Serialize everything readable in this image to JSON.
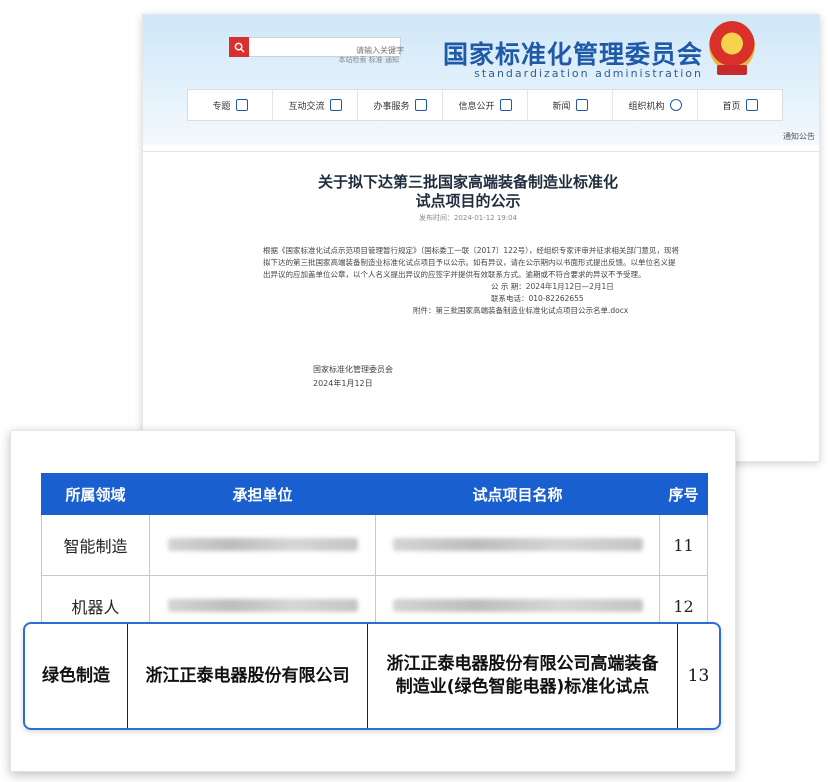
{
  "site": {
    "org_name": "国家标准化管理委员会",
    "org_name_en": "standardization administration",
    "search_placeholder": "请输入关键字",
    "search_hint": "本站检索  标准  通知"
  },
  "nav": [
    {
      "label": "首页",
      "icon": "home-icon"
    },
    {
      "label": "组织机构",
      "icon": "org-icon"
    },
    {
      "label": "新闻",
      "icon": "news-icon"
    },
    {
      "label": "信息公开",
      "icon": "doc-icon"
    },
    {
      "label": "办事服务",
      "icon": "service-icon"
    },
    {
      "label": "互动交流",
      "icon": "chat-icon"
    },
    {
      "label": "专题",
      "icon": "topic-icon"
    }
  ],
  "breadcrumb": "通知公告",
  "article": {
    "title_line1": "关于拟下达第三批国家高端装备制造业标准化",
    "title_line2": "试点项目的公示",
    "date": "发布时间：2024-01-12 19:04",
    "para1": "根据《国家标准化试点示范项目管理暂行规定》（国标委工一联〔2017〕122号），经组织专家评审并征求相关部门意见，现将拟下达的第三批国家高端装备制造业标准化试点项目予以公示。如有异议，请在公示期内以书面形式提出反馈。以单位名义提出异议的应加盖单位公章，以个人名义提出异议的应签字并提供有效联系方式。逾期或不符合要求的异议不予受理。",
    "period": "公 示 期：2024年1月12日—2月1日",
    "phone": "联系电话：010-82262655",
    "attachment": "附件：第三批国家高端装备制造业标准化试点项目公示名单.docx",
    "sign_org": "国家标准化管理委员会",
    "sign_date": "2024年1月12日"
  },
  "table": {
    "headers": [
      "序号",
      "试点项目名称",
      "承担单位",
      "所属领域"
    ],
    "rows": [
      {
        "seq": "11",
        "field": "智能制造"
      },
      {
        "seq": "12",
        "field": "机器人"
      }
    ],
    "highlight_row": {
      "seq": "13",
      "project_line1": "浙江正泰电器股份有限公司高端装备",
      "project_line2": "制造业(绿色智能电器)标准化试点",
      "unit": "浙江正泰电器股份有限公司",
      "field": "绿色制造"
    }
  },
  "colors": {
    "accent": "#1a5fcf",
    "highlight_border": "#2b6fd6",
    "search_button": "#d9302b"
  }
}
